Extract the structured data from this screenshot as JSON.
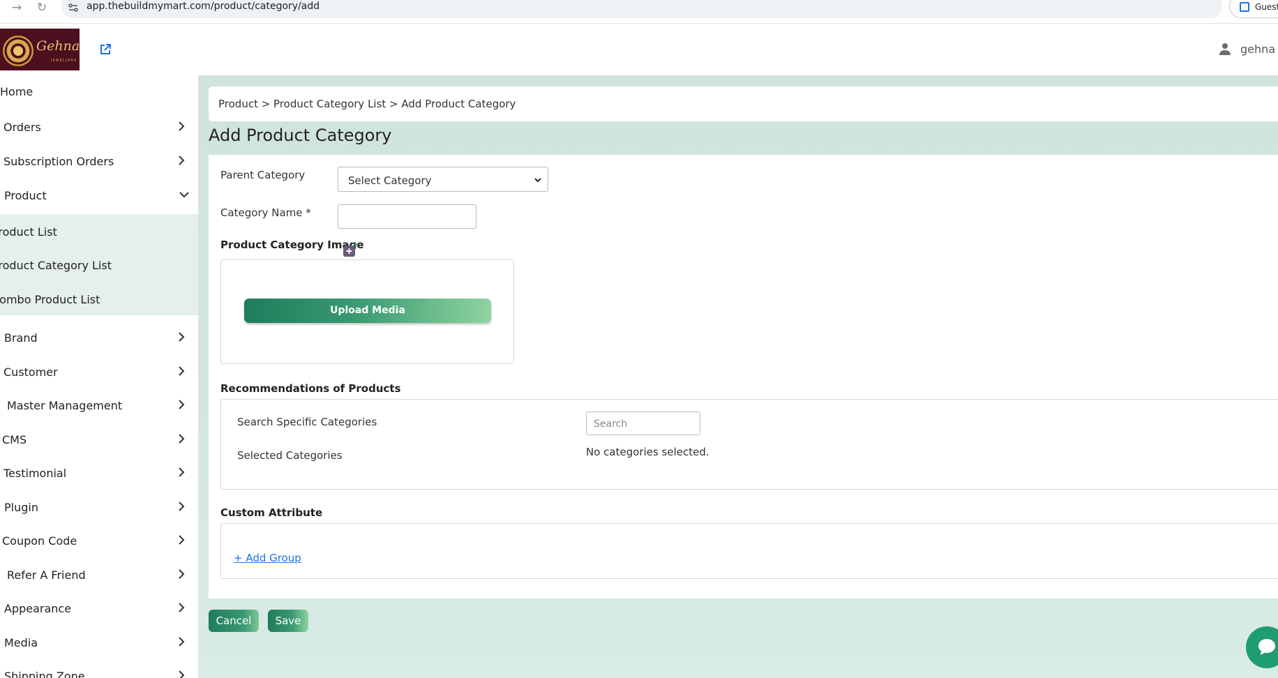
{
  "browser": {
    "url": "app.thebuildmymart.com/product/category/add",
    "profile_label": "Guest"
  },
  "header": {
    "logo_text": "Gehna",
    "logo_subtext": "JEWELLERS",
    "user_name": "gehna"
  },
  "sidebar": {
    "items": [
      {
        "label": "Home"
      },
      {
        "label": "Orders"
      },
      {
        "label": "Subscription Orders"
      },
      {
        "label": "Product"
      },
      {
        "label": "Brand"
      },
      {
        "label": "Customer"
      },
      {
        "label": "Master Management"
      },
      {
        "label": "CMS"
      },
      {
        "label": "Testimonial"
      },
      {
        "label": "Plugin"
      },
      {
        "label": "Coupon Code"
      },
      {
        "label": "Refer A Friend"
      },
      {
        "label": "Appearance"
      },
      {
        "label": "Media"
      },
      {
        "label": "Shipping Zone"
      }
    ],
    "product_submenu": [
      {
        "label": "Product List"
      },
      {
        "label": "Product Category List"
      },
      {
        "label": "Combo Product List"
      }
    ]
  },
  "breadcrumb": "Product > Product Category List > Add Product Category",
  "page_title": "Add Product Category",
  "form": {
    "parent_category_label": "Parent Category",
    "parent_category_value": "Select Category",
    "category_name_label": "Category Name *",
    "category_name_value": "",
    "image_label": "Product Category Image",
    "upload_button": "Upload Media",
    "recommendations_label": "Recommendations of Products",
    "search_categories_label": "Search Specific Categories",
    "search_placeholder": "Search",
    "selected_categories_label": "Selected Categories",
    "selected_categories_value": "No categories selected.",
    "custom_attribute_label": "Custom Attribute",
    "add_group_link": "+ Add Group"
  },
  "actions": {
    "cancel": "Cancel",
    "save": "Save"
  },
  "colors": {
    "accent": "#1f7c5c",
    "main_bg": "#d3e7e1",
    "submenu_bg": "#e5efec",
    "link": "#1a73e8"
  }
}
